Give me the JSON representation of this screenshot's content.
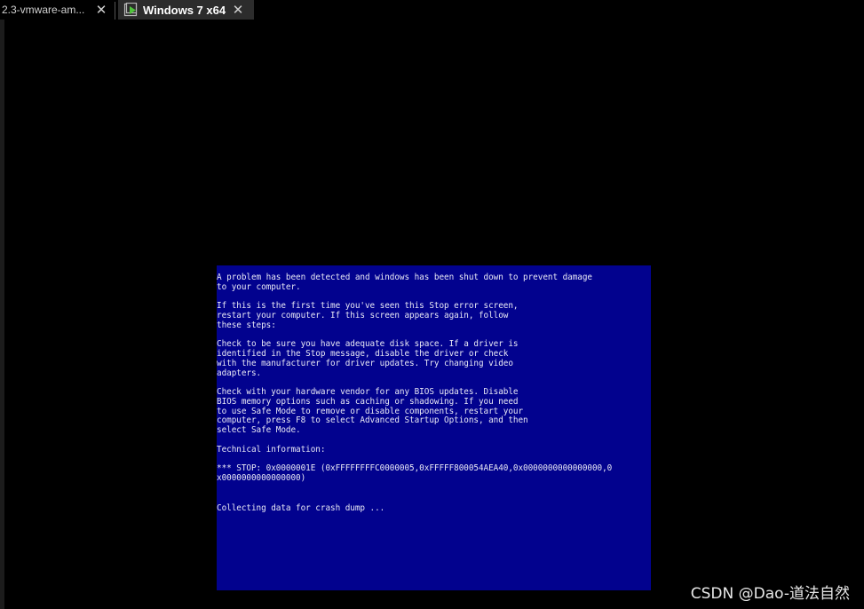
{
  "tabs": [
    {
      "label": "2.3-vmware-am...",
      "active": false,
      "close_glyph": "✕"
    },
    {
      "label": "Windows 7 x64",
      "active": true,
      "close_glyph": "✕",
      "icon": "vm-play-icon"
    }
  ],
  "bsod": {
    "background_color": "#02028e",
    "text_color": "#e9e9f5",
    "paragraphs": [
      "A problem has been detected and windows has been shut down to prevent damage\nto your computer.",
      "If this is the first time you've seen this Stop error screen,\nrestart your computer. If this screen appears again, follow\nthese steps:",
      "Check to be sure you have adequate disk space. If a driver is\nidentified in the Stop message, disable the driver or check\nwith the manufacturer for driver updates. Try changing video\nadapters.",
      "Check with your hardware vendor for any BIOS updates. Disable\nBIOS memory options such as caching or shadowing. If you need\nto use Safe Mode to remove or disable components, restart your\ncomputer, press F8 to select Advanced Startup Options, and then\nselect Safe Mode.",
      "Technical information:",
      "*** STOP: 0x0000001E (0xFFFFFFFFC0000005,0xFFFFF800054AEA40,0x0000000000000000,0\nx0000000000000000)",
      "Collecting data for crash dump ..."
    ]
  },
  "watermark": "CSDN @Dao-道法自然"
}
